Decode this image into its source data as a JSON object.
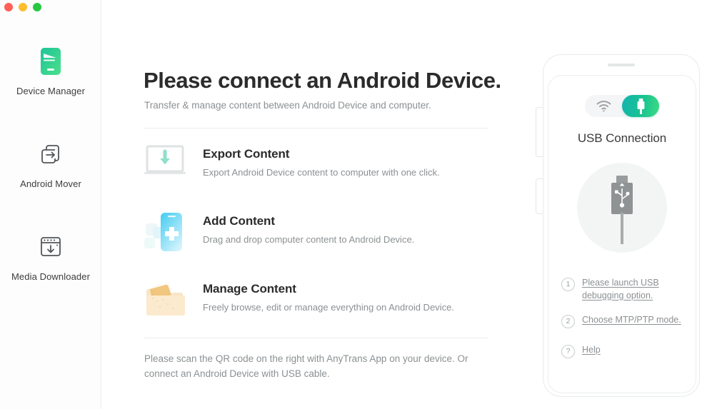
{
  "window": {
    "traffic_lights": [
      {
        "name": "close",
        "color": "#ff5f57"
      },
      {
        "name": "minimize",
        "color": "#ffbd2e"
      },
      {
        "name": "maximize",
        "color": "#28c840"
      }
    ]
  },
  "sidebar": {
    "items": [
      {
        "icon": "device-manager-icon",
        "label": "Device Manager"
      },
      {
        "icon": "android-mover-icon",
        "label": "Android Mover"
      },
      {
        "icon": "media-downloader-icon",
        "label": "Media Downloader"
      }
    ]
  },
  "main": {
    "headline": "Please connect an Android Device.",
    "subhead": "Transfer & manage content between Android Device and computer.",
    "features": [
      {
        "icon": "export-content-icon",
        "title": "Export Content",
        "desc": "Export Android Device content to computer with one click."
      },
      {
        "icon": "add-content-icon",
        "title": "Add Content",
        "desc": "Drag and drop computer content to Android Device."
      },
      {
        "icon": "manage-content-icon",
        "title": "Manage Content",
        "desc": "Freely browse, edit or manage everything on Android Device."
      }
    ],
    "bottom_note": "Please scan the QR code on the right with AnyTrans App on your device. Or connect an Android Device with USB cable."
  },
  "phone_panel": {
    "toggle": {
      "wifi": {
        "icon": "wifi-icon",
        "active": false
      },
      "usb": {
        "icon": "usb-plug-icon",
        "active": true
      }
    },
    "title": "USB Connection",
    "graphic_icon": "usb-connector-icon",
    "steps": [
      {
        "num": "1",
        "label": "Please launch USB debugging option."
      },
      {
        "num": "2",
        "label": "Choose MTP/PTP mode."
      },
      {
        "num": "?",
        "label": "Help"
      }
    ]
  },
  "colors": {
    "accent_green": "#3ddc84",
    "accent_teal": "#12b3b0",
    "text_primary": "#2b2b2b",
    "text_muted": "#8c9093",
    "border": "#ececec"
  }
}
